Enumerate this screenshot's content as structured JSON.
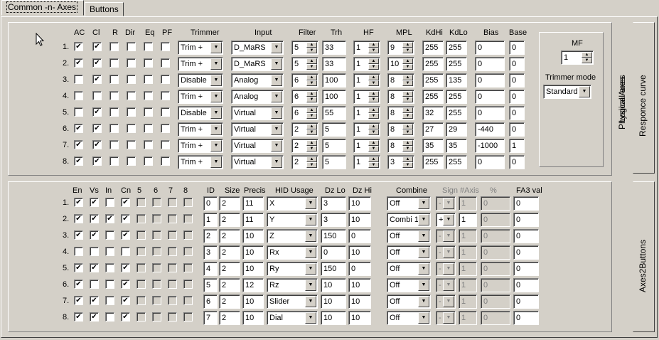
{
  "tabs": [
    "Common -n- Axes",
    "Buttons"
  ],
  "physical": {
    "headers": {
      "AC": "AC",
      "Cl": "Cl",
      "R": "R",
      "Dir": "Dir",
      "Eq": "Eq",
      "PF": "PF",
      "Trimmer": "Trimmer",
      "Input": "Input",
      "Filter": "Filter",
      "Trh": "Trh",
      "HF": "HF",
      "MPL": "MPL",
      "KdHi": "KdHi",
      "KdLo": "KdLo",
      "Bias": "Bias",
      "Base": "Base"
    },
    "rows": [
      {
        "n": "1.",
        "checks": [
          true,
          true,
          false,
          false,
          false,
          false
        ],
        "trimmer": "Trim +",
        "input": "D_MaRS",
        "filter": "5",
        "trh": "33",
        "hf": "1",
        "mpl": "9",
        "kdhi": "255",
        "kdlo": "255",
        "bias": "0",
        "base": "0"
      },
      {
        "n": "2.",
        "checks": [
          true,
          true,
          false,
          false,
          false,
          false
        ],
        "trimmer": "Trim +",
        "input": "D_MaRS",
        "filter": "5",
        "trh": "33",
        "hf": "1",
        "mpl": "10",
        "kdhi": "255",
        "kdlo": "255",
        "bias": "0",
        "base": "0"
      },
      {
        "n": "3.",
        "checks": [
          false,
          true,
          false,
          false,
          false,
          false
        ],
        "trimmer": "Disable",
        "input": "Analog",
        "filter": "6",
        "trh": "100",
        "hf": "1",
        "mpl": "8",
        "kdhi": "255",
        "kdlo": "135",
        "bias": "0",
        "base": "0"
      },
      {
        "n": "4.",
        "checks": [
          false,
          false,
          false,
          false,
          false,
          false
        ],
        "trimmer": "Trim +",
        "input": "Analog",
        "filter": "6",
        "trh": "100",
        "hf": "1",
        "mpl": "8",
        "kdhi": "255",
        "kdlo": "255",
        "bias": "0",
        "base": "0"
      },
      {
        "n": "5.",
        "checks": [
          false,
          true,
          false,
          false,
          false,
          false
        ],
        "trimmer": "Disable",
        "input": "Virtual",
        "filter": "6",
        "trh": "55",
        "hf": "1",
        "mpl": "8",
        "kdhi": "32",
        "kdlo": "255",
        "bias": "0",
        "base": "0"
      },
      {
        "n": "6.",
        "checks": [
          true,
          true,
          false,
          false,
          false,
          false
        ],
        "trimmer": "Trim +",
        "input": "Virtual",
        "filter": "2",
        "trh": "5",
        "hf": "1",
        "mpl": "8",
        "kdhi": "27",
        "kdlo": "29",
        "bias": "-440",
        "base": "0"
      },
      {
        "n": "7.",
        "checks": [
          true,
          true,
          false,
          false,
          false,
          false
        ],
        "trimmer": "Trim +",
        "input": "Virtual",
        "filter": "2",
        "trh": "5",
        "hf": "1",
        "mpl": "8",
        "kdhi": "35",
        "kdlo": "35",
        "bias": "-1000",
        "base": "1"
      },
      {
        "n": "8.",
        "checks": [
          true,
          true,
          false,
          false,
          false,
          false
        ],
        "trimmer": "Trim +",
        "input": "Virtual",
        "filter": "2",
        "trh": "5",
        "hf": "1",
        "mpl": "3",
        "kdhi": "255",
        "kdlo": "255",
        "bias": "0",
        "base": "0"
      }
    ],
    "mf_label": "MF",
    "mf_value": "1",
    "trimmer_mode_label": "Trimmer mode",
    "trimmer_mode_value": "Standard",
    "side_label": "Physical Axes",
    "tab_label": "Responce curve"
  },
  "logical": {
    "headers": {
      "En": "En",
      "Vs": "Vs",
      "In": "In",
      "Cn": "Cn",
      "c5": "5",
      "c6": "6",
      "c7": "7",
      "c8": "8",
      "ID": "ID",
      "Size": "Size",
      "Precis": "Precis",
      "HID": "HID Usage",
      "DzLo": "Dz Lo",
      "DzHi": "Dz Hi",
      "Combine": "Combine",
      "Sign": "Sign",
      "Axis": "#Axis",
      "Pct": "%",
      "FA3": "FA3 val"
    },
    "rows": [
      {
        "n": "1.",
        "checks": [
          true,
          true,
          false,
          true,
          false,
          false,
          false,
          false
        ],
        "id": "0",
        "size": "2",
        "precis": "11",
        "hid": "X",
        "dzlo": "3",
        "dzhi": "10",
        "combine": "Off",
        "sign": "-",
        "axis": "1",
        "pct": "0",
        "fa3": "0"
      },
      {
        "n": "2.",
        "checks": [
          true,
          true,
          true,
          true,
          false,
          false,
          false,
          false
        ],
        "id": "1",
        "size": "2",
        "precis": "11",
        "hid": "Y",
        "dzlo": "3",
        "dzhi": "10",
        "combine": "Combi 1",
        "sign": "+",
        "axis": "1",
        "pct": "0",
        "fa3": "0"
      },
      {
        "n": "3.",
        "checks": [
          true,
          true,
          false,
          true,
          false,
          false,
          false,
          false
        ],
        "id": "2",
        "size": "2",
        "precis": "10",
        "hid": "Z",
        "dzlo": "150",
        "dzhi": "0",
        "combine": "Off",
        "sign": "-",
        "axis": "1",
        "pct": "0",
        "fa3": "0"
      },
      {
        "n": "4.",
        "checks": [
          false,
          false,
          false,
          false,
          false,
          false,
          false,
          false
        ],
        "id": "3",
        "size": "2",
        "precis": "10",
        "hid": "Rx",
        "dzlo": "0",
        "dzhi": "10",
        "combine": "Off",
        "sign": "-",
        "axis": "1",
        "pct": "0",
        "fa3": "0"
      },
      {
        "n": "5.",
        "checks": [
          true,
          true,
          false,
          true,
          false,
          false,
          false,
          false
        ],
        "id": "4",
        "size": "2",
        "precis": "10",
        "hid": "Ry",
        "dzlo": "150",
        "dzhi": "0",
        "combine": "Off",
        "sign": "-",
        "axis": "1",
        "pct": "0",
        "fa3": "0"
      },
      {
        "n": "6.",
        "checks": [
          true,
          false,
          false,
          true,
          false,
          false,
          false,
          false
        ],
        "id": "5",
        "size": "2",
        "precis": "12",
        "hid": "Rz",
        "dzlo": "10",
        "dzhi": "10",
        "combine": "Off",
        "sign": "-",
        "axis": "1",
        "pct": "0",
        "fa3": "0"
      },
      {
        "n": "7.",
        "checks": [
          true,
          true,
          false,
          true,
          false,
          false,
          false,
          false
        ],
        "id": "6",
        "size": "2",
        "precis": "10",
        "hid": "Slider",
        "dzlo": "10",
        "dzhi": "10",
        "combine": "Off",
        "sign": "-",
        "axis": "1",
        "pct": "0",
        "fa3": "0"
      },
      {
        "n": "8.",
        "checks": [
          true,
          true,
          false,
          true,
          false,
          false,
          false,
          false
        ],
        "id": "7",
        "size": "2",
        "precis": "10",
        "hid": "Dial",
        "dzlo": "10",
        "dzhi": "10",
        "combine": "Off",
        "sign": "-",
        "axis": "1",
        "pct": "0",
        "fa3": "0"
      }
    ],
    "side_label": "Logical axes",
    "tab_label": "Axes2Buttons"
  },
  "icons": {
    "check": "checkmark-icon",
    "dropdown": "dropdown-arrow-icon",
    "spin": "spin-arrows-icon",
    "cursor": "mouse-cursor-icon"
  }
}
